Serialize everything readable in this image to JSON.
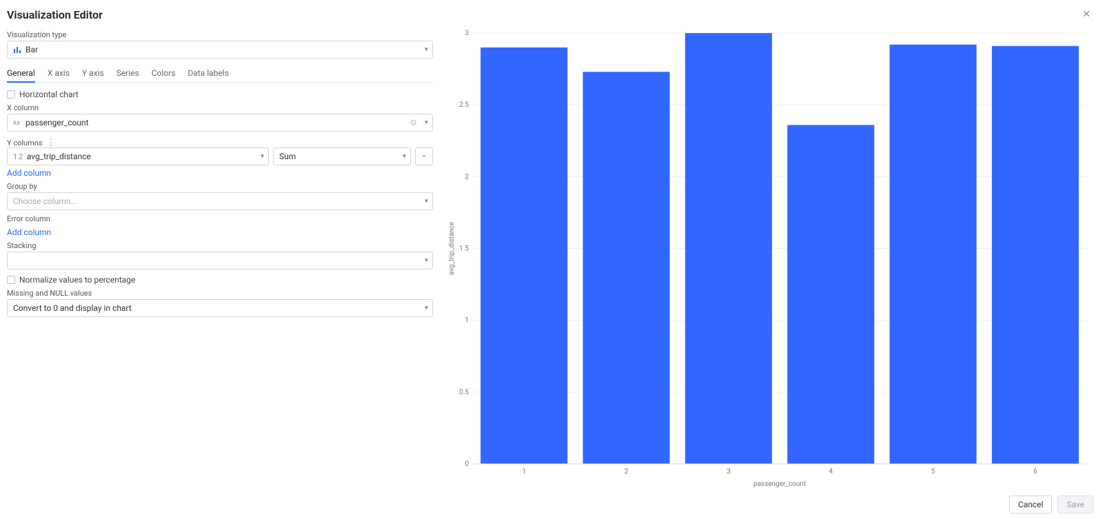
{
  "title": "Visualization Editor",
  "viz_type": {
    "label": "Visualization type",
    "value": "Bar"
  },
  "tabs": [
    "General",
    "X axis",
    "Y axis",
    "Series",
    "Colors",
    "Data labels"
  ],
  "active_tab": "General",
  "general": {
    "horizontal_label": "Horizontal chart",
    "xcol": {
      "label": "X column",
      "value": "passenger_count"
    },
    "ycols_label": "Y columns",
    "ycols": [
      {
        "col": "avg_trip_distance",
        "agg": "Sum"
      }
    ],
    "add_column": "Add column",
    "groupby": {
      "label": "Group by",
      "placeholder": "Choose column..."
    },
    "errorcol_label": "Error column",
    "stacking": {
      "label": "Stacking",
      "value": ""
    },
    "normalize_label": "Normalize values to percentage",
    "missing": {
      "label": "Missing and NULL values",
      "value": "Convert to 0 and display in chart"
    }
  },
  "footer": {
    "cancel": "Cancel",
    "save": "Save"
  },
  "chart_data": {
    "type": "bar",
    "categories": [
      "1",
      "2",
      "3",
      "4",
      "5",
      "6"
    ],
    "values": [
      2.9,
      2.73,
      3.0,
      2.36,
      2.92,
      2.91
    ],
    "xlabel": "passenger_count",
    "ylabel": "avg_trip_distance",
    "ylim": [
      0,
      3
    ],
    "yticks": [
      0,
      0.5,
      1,
      1.5,
      2,
      2.5,
      3
    ],
    "bar_color": "#3366ff"
  }
}
